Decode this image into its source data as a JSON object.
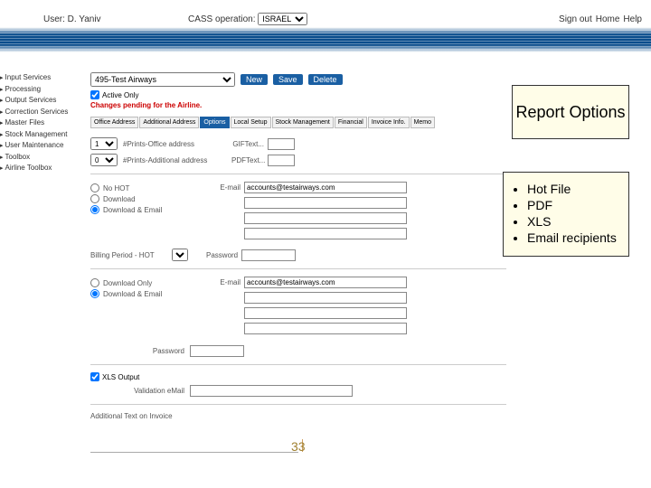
{
  "header": {
    "user_label": "User: D. Yaniv",
    "op_label": "CASS operation:",
    "op_value": "ISRAEL",
    "links": {
      "signout": "Sign out",
      "home": "Home",
      "help": "Help"
    }
  },
  "sidenav": [
    "Input Services",
    "Processing",
    "Output Services",
    "Correction Services",
    "Master Files",
    "Stock Management",
    "User Maintenance",
    "Toolbox",
    "Airline Toolbox"
  ],
  "main": {
    "airline_select": "495-Test Airways",
    "buttons": {
      "new": "New",
      "save": "Save",
      "delete": "Delete"
    },
    "active_only": "Active Only",
    "warning": "Changes pending for the Airline.",
    "tabs": [
      "Office Address",
      "Additional Address",
      "Options",
      "Local Setup",
      "Stock Management",
      "Financial",
      "Invoice Info.",
      "Memo"
    ],
    "active_tab": "Options",
    "opt": {
      "prints_office": "#Prints-Office address",
      "prints_addl": "#Prints-Additional address",
      "giftext": "GIFText...",
      "pdftext": "PDFText...",
      "no_hot": "No HOT",
      "download": "Download",
      "download_email": "Download & Email",
      "email_label": "E-mail",
      "email_val": "accounts@testairways.com",
      "billing_period": "Billing Period - HOT",
      "password": "Password",
      "download_only": "Download Only",
      "download_email2": "Download & Email",
      "email_val2": "accounts@testairways.com",
      "xls_output": "XLS Output",
      "validation_email": "Validation eMail",
      "addl_text": "Additional Text on Invoice"
    }
  },
  "callout": {
    "title": "Report Options",
    "items": [
      "Hot File",
      "PDF",
      "XLS",
      "Email recipients"
    ]
  },
  "page_number": "33"
}
